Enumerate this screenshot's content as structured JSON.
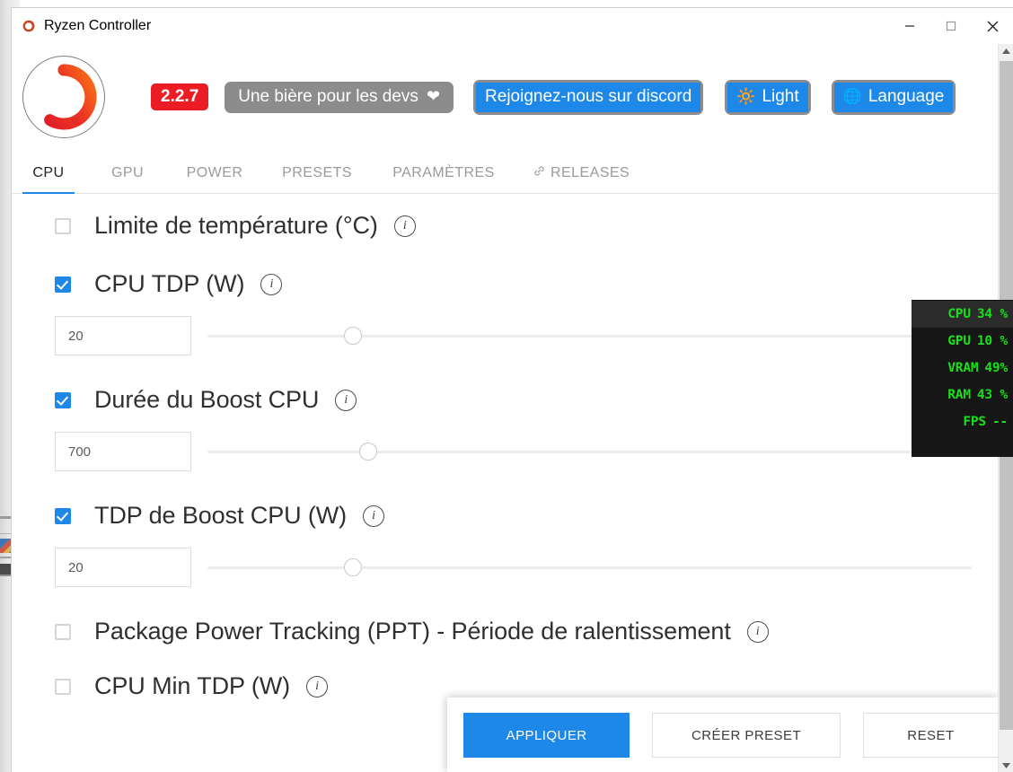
{
  "window": {
    "title": "Ryzen Controller",
    "app_icon": "ryzen-logo-icon",
    "minimize": "minimize-icon",
    "maximize": "maximize-icon",
    "close": "close-icon"
  },
  "header": {
    "logo_icon": "ryzen-ring-logo",
    "version": "2.2.7",
    "beer_label": "Une bière pour les devs",
    "beer_icon": "❤",
    "discord_label": "Rejoignez-nous sur discord",
    "light_label": "Light",
    "light_icon": "🔆",
    "language_label": "Language",
    "language_icon": "🌐"
  },
  "tabs": [
    {
      "id": "cpu",
      "label": "CPU",
      "active": true
    },
    {
      "id": "gpu",
      "label": "GPU",
      "active": false
    },
    {
      "id": "power",
      "label": "POWER",
      "active": false
    },
    {
      "id": "presets",
      "label": "PRESETS",
      "active": false
    },
    {
      "id": "parametres",
      "label": "PARAMÈTRES",
      "active": false
    },
    {
      "id": "releases",
      "label": "RELEASES",
      "active": false,
      "icon": "link-icon"
    }
  ],
  "settings": [
    {
      "id": "temp-limit",
      "label": "Limite de température (°C)",
      "checked": false,
      "has_control": false,
      "info": "i"
    },
    {
      "id": "cpu-tdp",
      "label": "CPU TDP (W)",
      "checked": true,
      "has_control": true,
      "value": "20",
      "slider_percent": 19,
      "info": "i"
    },
    {
      "id": "cpu-boost-time",
      "label": "Durée du Boost CPU",
      "checked": true,
      "has_control": true,
      "value": "700",
      "slider_percent": 21,
      "info": "i"
    },
    {
      "id": "cpu-boost-tdp",
      "label": "TDP de Boost CPU (W)",
      "checked": true,
      "has_control": true,
      "value": "20",
      "slider_percent": 19,
      "info": "i"
    },
    {
      "id": "ppt-slow",
      "label": "Package Power Tracking (PPT) - Période de ralentissement",
      "checked": false,
      "has_control": false,
      "info": "i"
    },
    {
      "id": "cpu-min-tdp",
      "label": "CPU Min TDP (W)",
      "checked": false,
      "has_control": false,
      "info": "i"
    }
  ],
  "overlay": {
    "rows": [
      {
        "label": "CPU",
        "value": "34 %",
        "highlight": true
      },
      {
        "label": "GPU",
        "value": "10 %",
        "highlight": false
      },
      {
        "label": "VRAM",
        "value": "49%",
        "highlight": false
      },
      {
        "label": "RAM",
        "value": "43 %",
        "highlight": false
      },
      {
        "label": "FPS",
        "value": "--",
        "highlight": false
      }
    ]
  },
  "actions": {
    "apply": "APPLIQUER",
    "create_preset": "CRÉER PRESET",
    "reset": "RESET"
  },
  "colors": {
    "accent_blue": "#1e88e8",
    "version_red": "#ec1c24",
    "overlay_green": "#19e019",
    "overlay_bg": "#161616"
  }
}
